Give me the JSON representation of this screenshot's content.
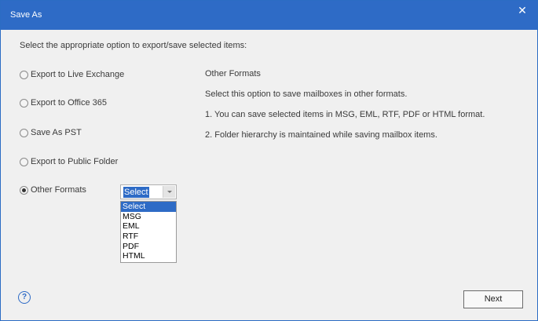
{
  "window": {
    "title": "Save As",
    "close_glyph": "✕"
  },
  "instruction": "Select the appropriate option to export/save selected items:",
  "options": [
    {
      "label": "Export to Live Exchange",
      "checked": false
    },
    {
      "label": "Export to Office 365",
      "checked": false
    },
    {
      "label": "Save As PST",
      "checked": false
    },
    {
      "label": "Export to Public Folder",
      "checked": false
    },
    {
      "label": "Other Formats",
      "checked": true
    }
  ],
  "info": {
    "title": "Other Formats",
    "line1": "Select this option to save mailboxes in other formats.",
    "line2": "1. You can save selected items in MSG, EML, RTF, PDF or HTML format.",
    "line3": "2. Folder hierarchy is maintained while saving mailbox items."
  },
  "format_select": {
    "value": "Select",
    "options": [
      "Select",
      "MSG",
      "EML",
      "RTF",
      "PDF",
      "HTML"
    ]
  },
  "footer": {
    "help_glyph": "?",
    "next_label": "Next"
  },
  "colors": {
    "accent": "#2e6bc6",
    "background": "#f0f0f0"
  },
  "icons": {
    "close": "close-icon",
    "help": "help-icon",
    "dropdown": "chevron-down-icon"
  }
}
